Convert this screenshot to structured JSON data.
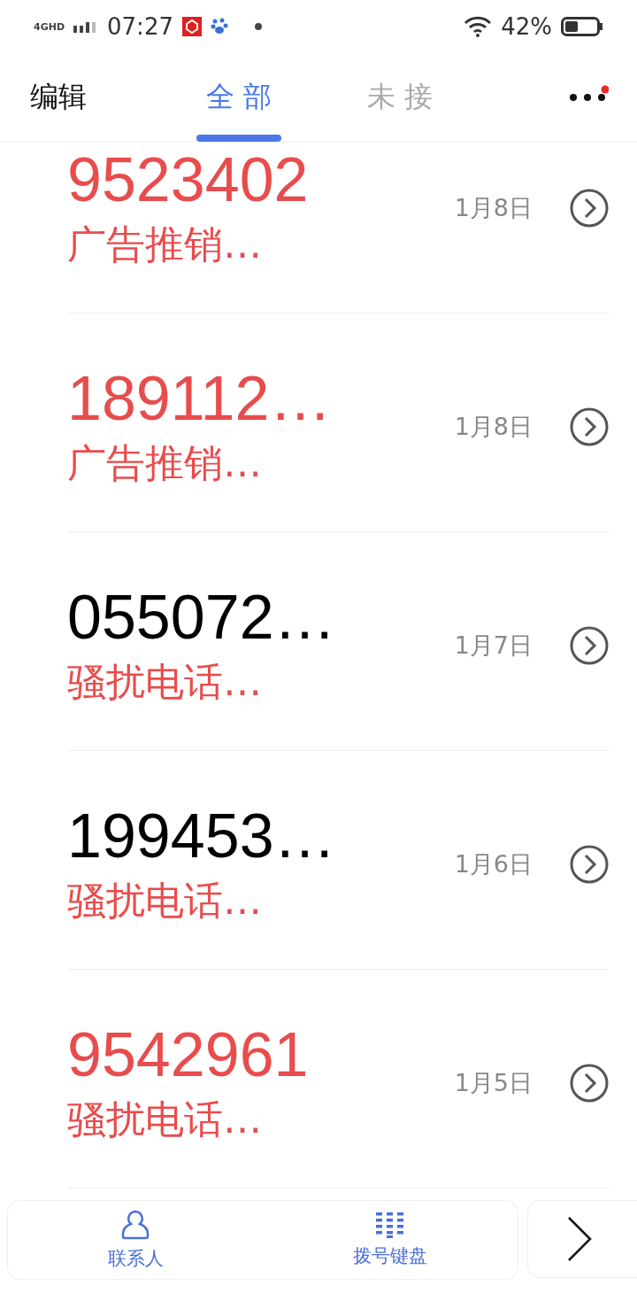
{
  "status_bar": {
    "network": "4GHD",
    "time": "07:27",
    "battery": "42%"
  },
  "header": {
    "edit": "编辑",
    "tabs": [
      {
        "label": "全 部",
        "selected": true
      },
      {
        "label": "未 接",
        "selected": false
      }
    ],
    "more_badge": true
  },
  "calls": [
    {
      "number": "9523402",
      "missed": true,
      "tag": "广告推销…",
      "date": "1月8日"
    },
    {
      "number": "189112…",
      "missed": true,
      "tag": "广告推销…",
      "date": "1月8日"
    },
    {
      "number": "055072…",
      "missed": false,
      "tag": "骚扰电话…",
      "date": "1月7日"
    },
    {
      "number": "199453…",
      "missed": false,
      "tag": "骚扰电话…",
      "date": "1月6日"
    },
    {
      "number": "9542961",
      "missed": true,
      "tag": "骚扰电话…",
      "date": "1月5日"
    }
  ],
  "bottom_bar": {
    "items": [
      {
        "kind": "contacts",
        "label": "联系人"
      },
      {
        "kind": "keypad",
        "label": "拨号键盘"
      }
    ]
  }
}
